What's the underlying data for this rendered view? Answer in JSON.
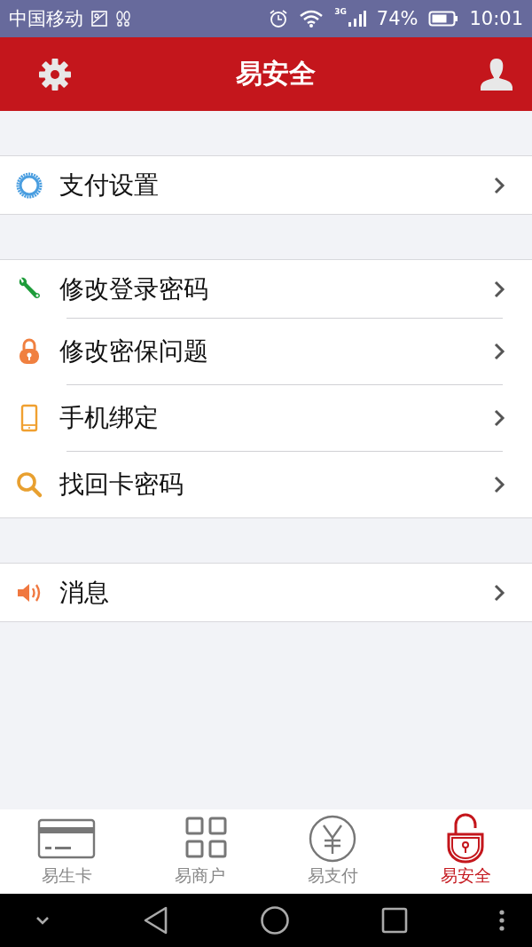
{
  "status_bar": {
    "carrier": "中国移动",
    "network": "3G",
    "battery": "74%",
    "time": "10:01"
  },
  "header": {
    "title": "易安全"
  },
  "groups": [
    {
      "items": [
        {
          "label": "支付设置"
        }
      ]
    },
    {
      "items": [
        {
          "label": "修改登录密码"
        },
        {
          "label": "修改密保问题"
        },
        {
          "label": "手机绑定"
        },
        {
          "label": "找回卡密码"
        }
      ]
    },
    {
      "items": [
        {
          "label": "消息"
        }
      ]
    }
  ],
  "tabs": [
    {
      "label": "易生卡",
      "selected": false
    },
    {
      "label": "易商户",
      "selected": false
    },
    {
      "label": "易支付",
      "selected": false
    },
    {
      "label": "易安全",
      "selected": true
    }
  ]
}
